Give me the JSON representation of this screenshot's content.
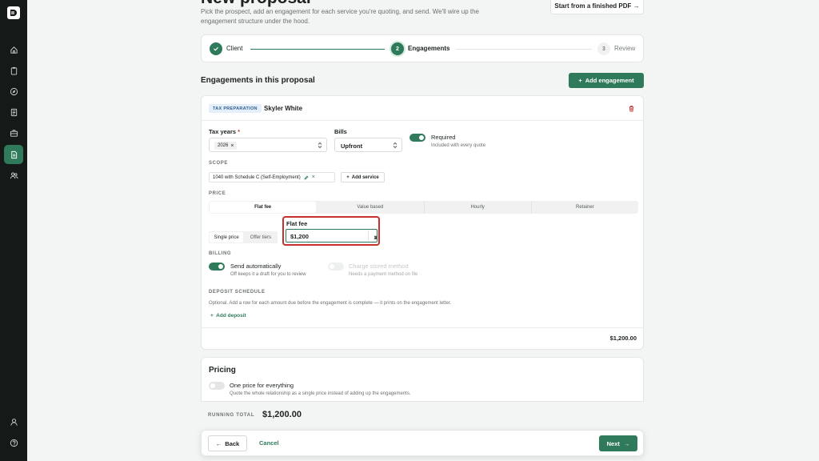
{
  "header": {
    "title": "New proposal",
    "subtitle": "Pick the prospect, add an engagement for each service you're quoting, and send. We'll wire up the engagement structure under the hood.",
    "pdf_button": "Start from a finished PDF →"
  },
  "stepper": {
    "steps": [
      {
        "label": "Client",
        "state": "done"
      },
      {
        "label": "Engagements",
        "number": "2",
        "state": "current"
      },
      {
        "label": "Review",
        "number": "3",
        "state": "todo"
      }
    ]
  },
  "section": {
    "title": "Engagements in this proposal",
    "add_button": "Add engagement"
  },
  "engagement": {
    "badge": "TAX PREPARATION",
    "client": "Skyler White",
    "tax_years": {
      "label": "Tax years",
      "required_mark": "*",
      "chips": [
        "2026"
      ]
    },
    "bills": {
      "label": "Bills",
      "value": "Upfront"
    },
    "required_toggle": {
      "label": "Required",
      "sub": "Included with every quote",
      "on": true
    },
    "scope": {
      "heading": "SCOPE",
      "service": "1040 with Schedule C (Self-Employment)",
      "add_button": "Add service"
    },
    "price": {
      "heading": "PRICE",
      "tabs": [
        "Flat fee",
        "Value based",
        "Hourly",
        "Retainer"
      ],
      "active_tab": "Flat fee",
      "modes": [
        "Single price",
        "Offer tiers"
      ],
      "active_mode": "Single price",
      "flat_fee_label": "Flat fee",
      "flat_fee_value": "$1,200"
    },
    "billing": {
      "heading": "BILLING",
      "send_auto": {
        "label": "Send automatically",
        "sub": "Off keeps it a draft for you to review",
        "on": true
      },
      "charge": {
        "label": "Charge stored method",
        "sub": "Needs a payment method on file",
        "on": false
      }
    },
    "deposit": {
      "heading": "DEPOSIT SCHEDULE",
      "description": "Optional. Add a row for each amount due before the engagement is complete — it prints on the engagement letter.",
      "add_button": "Add deposit"
    },
    "total": "$1,200.00"
  },
  "pricing": {
    "title": "Pricing",
    "toggle": {
      "label": "One price for everything",
      "sub": "Quote the whole relationship as a single price instead of adding up the engagements.",
      "on": false
    }
  },
  "running_total": {
    "label": "RUNNING TOTAL",
    "value": "$1,200.00"
  },
  "footer": {
    "back": "Back",
    "cancel": "Cancel",
    "next": "Next"
  },
  "colors": {
    "accent": "#2f7a5a",
    "sidebar": "#151918",
    "focus_outline": "#c8302f",
    "badge_bg": "#e4effb"
  },
  "sidebar": {
    "icons": [
      "logo",
      "home-icon",
      "clipboard-icon",
      "compass-icon",
      "ledger-icon",
      "briefcase-icon",
      "document-icon",
      "people-icon",
      "user-icon",
      "help-icon"
    ],
    "active": "document-icon"
  }
}
